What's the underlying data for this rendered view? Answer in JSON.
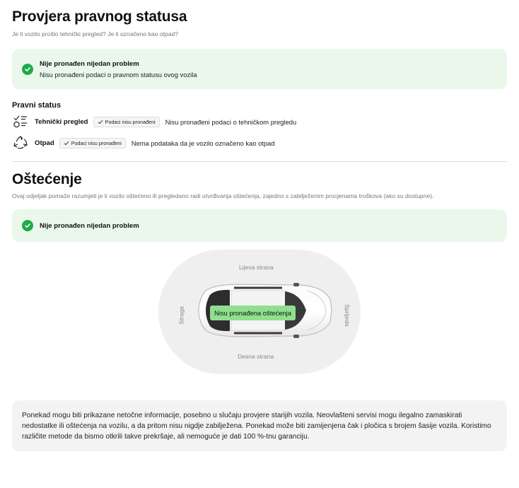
{
  "legal": {
    "title": "Provjera pravnog statusa",
    "subtitle": "Je li vozilo prošlo tehnički pregled? Je li označeno kao otpad?",
    "ok_box": {
      "title": "Nije pronađen nijedan problem",
      "description": "Nisu pronađeni podaci o pravnom statusu ovog vozila"
    },
    "section_label": "Pravni status",
    "rows": [
      {
        "icon": "checklist-icon",
        "name": "Tehnički pregled",
        "badge": "Podaci nisu pronađeni",
        "text": "Nisu pronađeni podaci o tehničkom pregledu"
      },
      {
        "icon": "recycle-icon",
        "name": "Otpad",
        "badge": "Podaci nisu pronađeni",
        "text": "Nema podataka da je vozilo označeno kao otpad"
      }
    ]
  },
  "damage": {
    "title": "Oštećenje",
    "subtitle": "Ovaj odjeljak pomaže razumjeti je li vozilo oštećeno ili pregledano radi utvrđivanja oštećenja, zajedno s zabilježenim procjenama troškova (ako su dostupne).",
    "ok_box": {
      "title": "Nije pronađen nijedan problem"
    },
    "diagram": {
      "left_side": "Lijeva strana",
      "right_side": "Desna strana",
      "rear": "Straga",
      "front": "Sprijeda",
      "status_label": "Nisu pronađena oštećenja"
    }
  },
  "note": "Ponekad mogu biti prikazane netočne informacije, posebno u slučaju provjere starijih vozila. Neovlašteni servisi mogu ilegalno zamaskirati nedostatke ili oštećenja na vozilu, a da pritom nisu nigdje zabilježena. Ponekad može biti zamijenjena čak i pločica s brojem šasije vozila. Koristimo različite metode da bismo otkrili takve prekršaje, ali nemoguće je dati 100 %-tnu garanciju.",
  "colors": {
    "ok_bg": "#e9f8ea",
    "ok_check": "#1faa4a",
    "damage_label_bg": "#8ee08f"
  }
}
